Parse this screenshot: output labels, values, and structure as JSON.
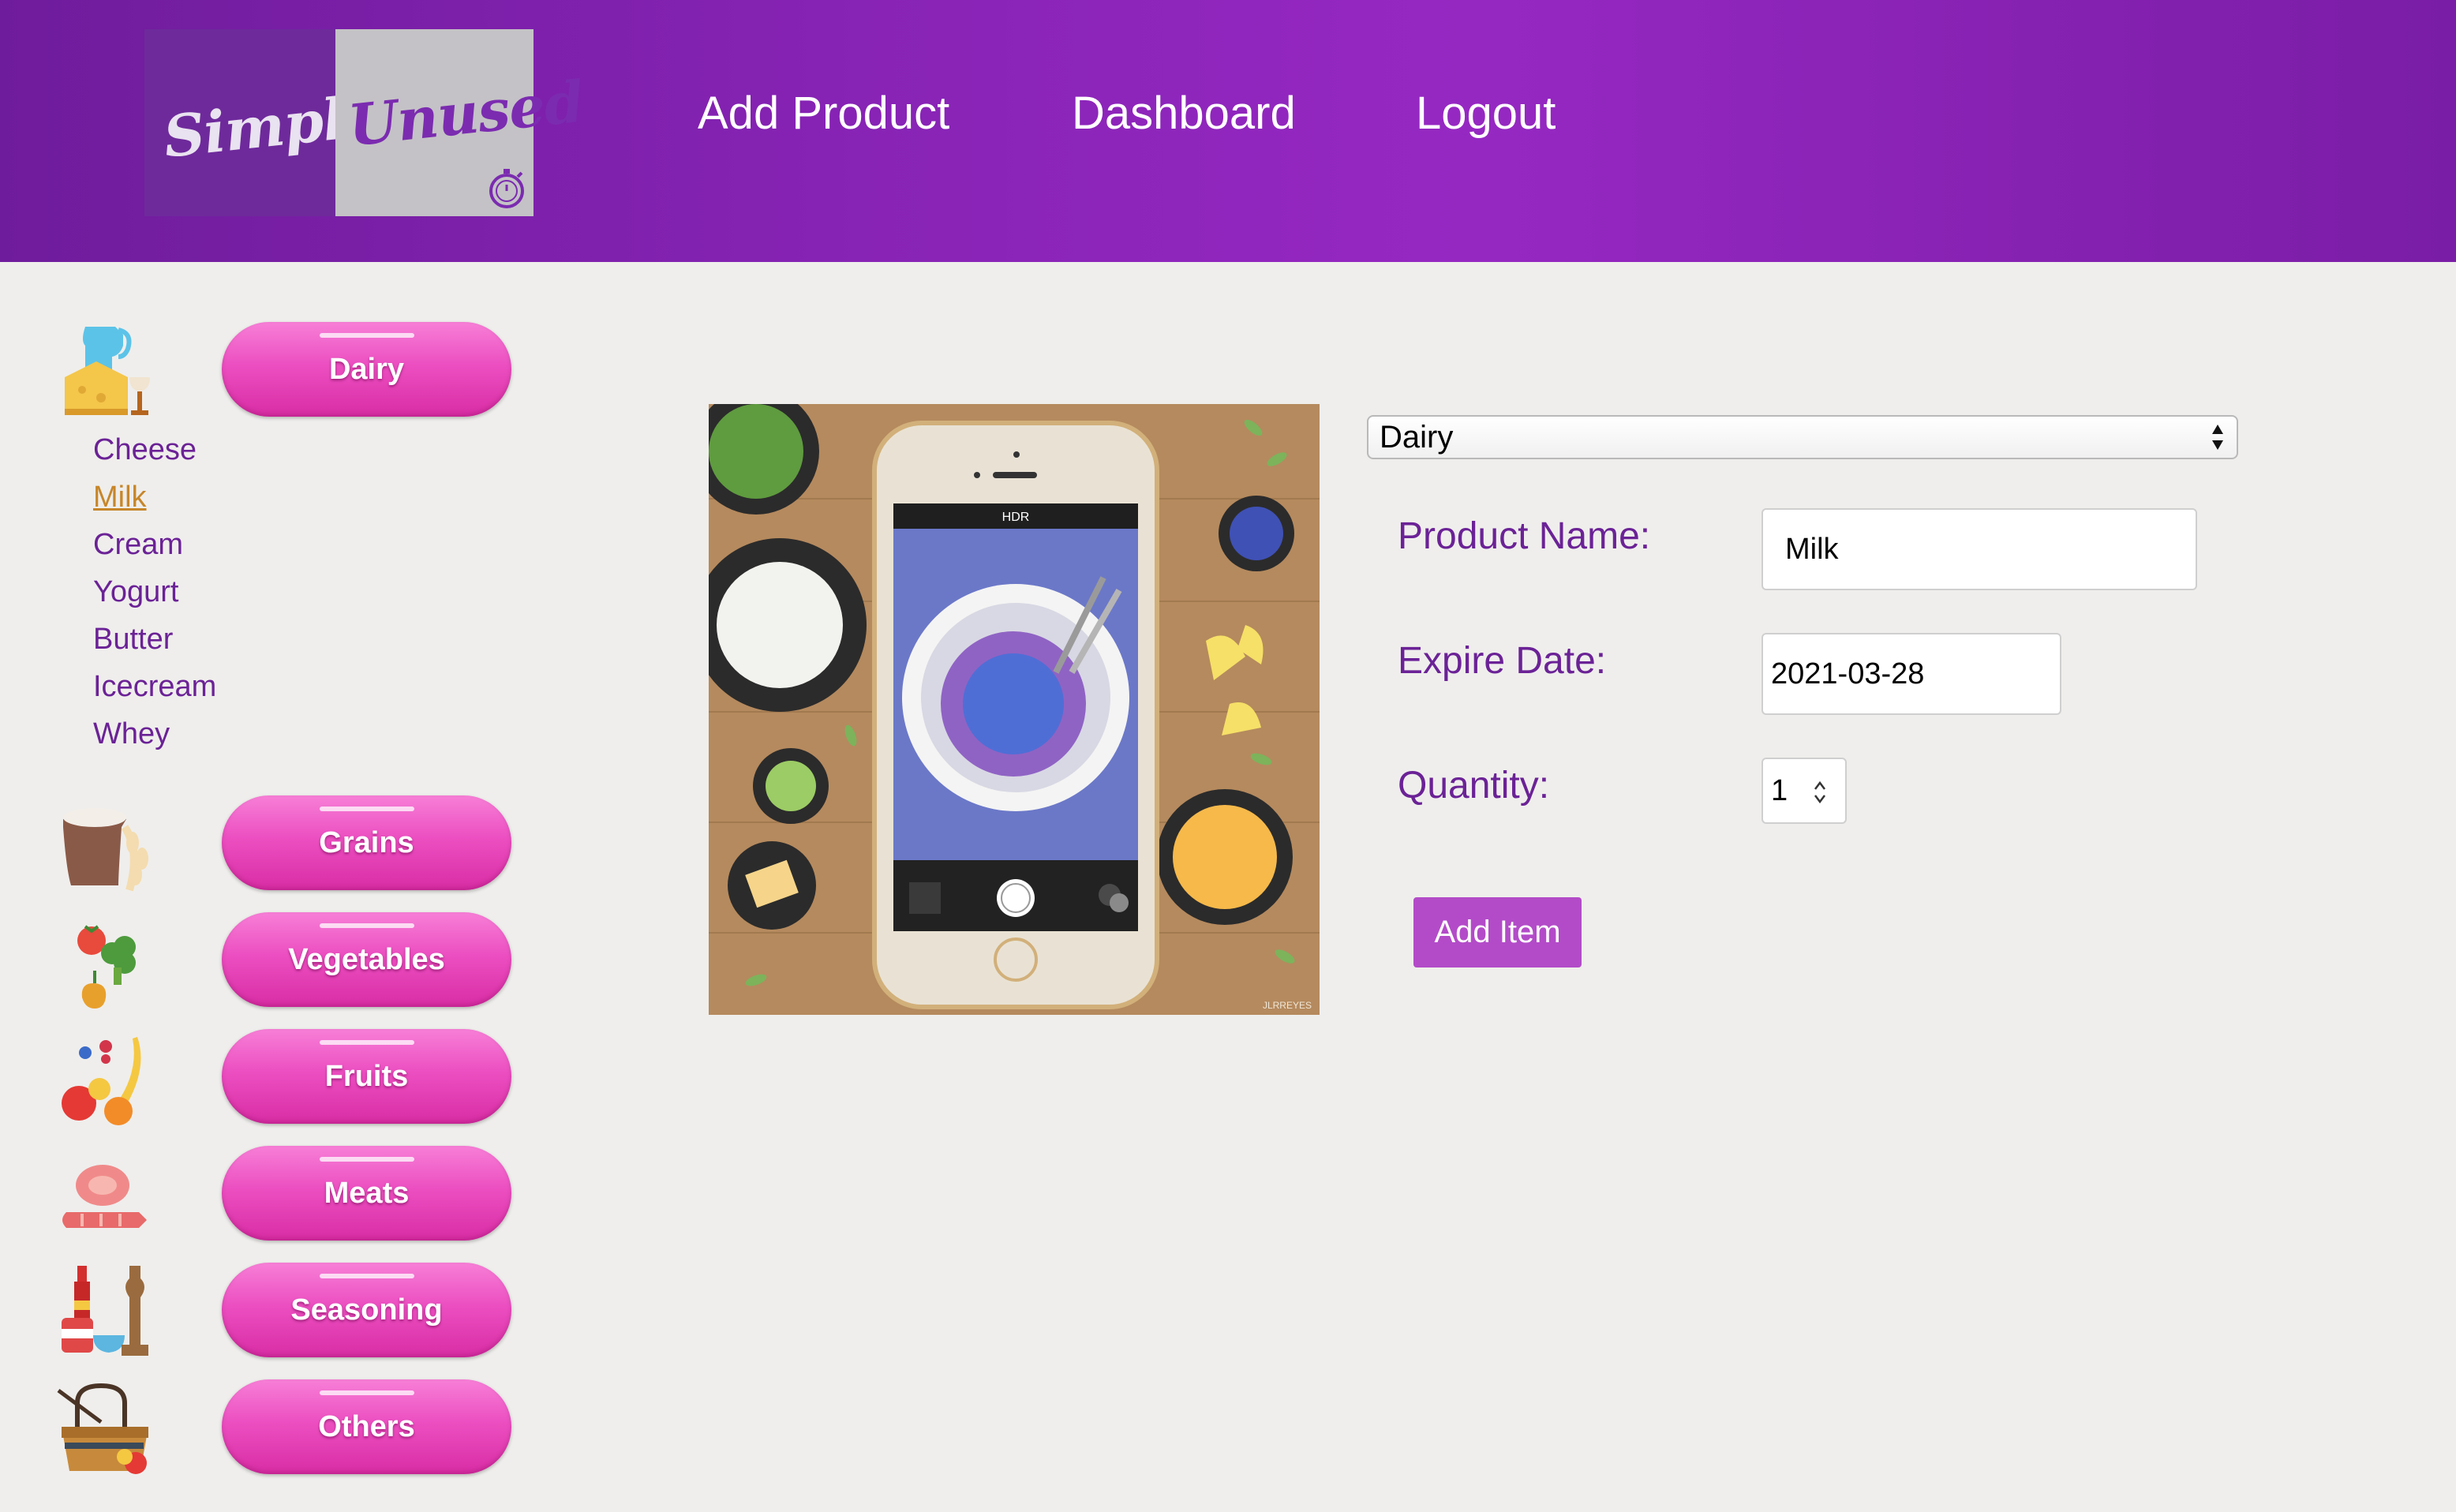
{
  "header": {
    "logo_left_text": "Simply",
    "logo_right_text": "Unused",
    "nav": [
      "Add Product",
      "Dashboard",
      "Logout"
    ]
  },
  "sidebar": {
    "categories": [
      {
        "label": "Dairy",
        "icon": "dairy-icon"
      },
      {
        "label": "Grains",
        "icon": "grains-icon"
      },
      {
        "label": "Vegetables",
        "icon": "vegetables-icon"
      },
      {
        "label": "Fruits",
        "icon": "fruits-icon"
      },
      {
        "label": "Meats",
        "icon": "meats-icon"
      },
      {
        "label": "Seasoning",
        "icon": "seasoning-icon"
      },
      {
        "label": "Others",
        "icon": "others-icon"
      }
    ],
    "dairy_items": [
      "Cheese",
      "Milk",
      "Cream",
      "Yogurt",
      "Butter",
      "Icecream",
      "Whey"
    ],
    "active_item": "Milk"
  },
  "hero": {
    "description": "",
    "hdr_label": "HDR",
    "watermark": "JLRREYES"
  },
  "form": {
    "category_selected": "Dairy",
    "product_name_label": "Product Name:",
    "product_name_value": "Milk",
    "expire_date_label": "Expire Date:",
    "expire_date_value": "2021-03-28",
    "quantity_label": "Quantity:",
    "quantity_value": "1",
    "add_button": "Add Item"
  },
  "colors": {
    "header": "#8723b5",
    "pill": "#ec4fc1",
    "label": "#6b2296",
    "button": "#b34bc8",
    "active_link": "#c7862a"
  }
}
